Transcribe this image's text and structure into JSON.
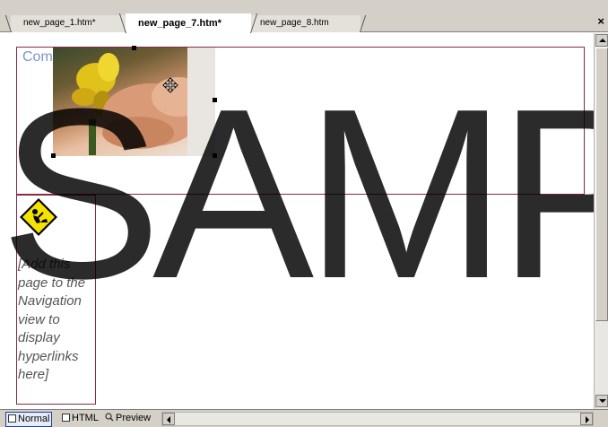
{
  "tabs": [
    {
      "label": "new_page_1.htm*",
      "active": false
    },
    {
      "label": "new_page_7.htm*",
      "active": true
    },
    {
      "label": "new_page_8.htm",
      "active": false
    }
  ],
  "close_symbol": "×",
  "content": {
    "comp_text": "Com",
    "photo_icon": "move-cursor-icon",
    "nav_sign_icon": "construction-sign-icon",
    "nav_placeholder": "[Add this page to the Navigation view to display hyperlinks here]"
  },
  "watermark": "SAMPLE",
  "view_tabs": [
    {
      "label": "Normal",
      "active": true,
      "icon": "normal-view-icon"
    },
    {
      "label": "HTML",
      "active": false,
      "icon": "html-view-icon"
    },
    {
      "label": "Preview",
      "active": false,
      "icon": "preview-view-icon"
    }
  ],
  "colors": {
    "region_border": "#8b2846",
    "link_blue": "#7a96c8",
    "sign_yellow": "#f5e200"
  }
}
